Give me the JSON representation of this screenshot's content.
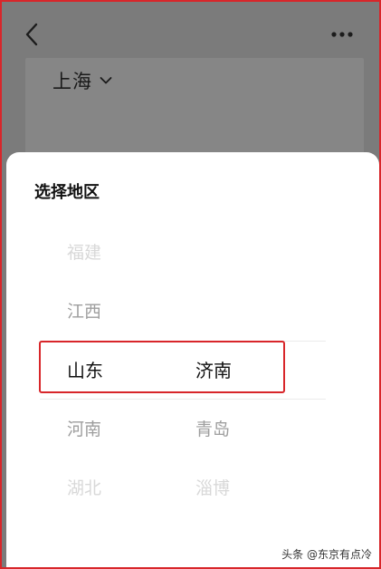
{
  "header": {
    "back_icon": "chevron-left-icon",
    "more_icon": "more-dots-icon"
  },
  "city_selector": {
    "label": "上海",
    "icon": "chevron-down-icon"
  },
  "picker": {
    "title": "选择地区",
    "rows": [
      {
        "province": "福建",
        "city": ""
      },
      {
        "province": "江西",
        "city": ""
      },
      {
        "province": "山东",
        "city": "济南"
      },
      {
        "province": "河南",
        "city": "青岛"
      },
      {
        "province": "湖北",
        "city": "淄博"
      }
    ],
    "selected_index": 2
  },
  "watermark": {
    "text": "头条 @东京有点冷"
  },
  "colors": {
    "overlay_gray": "#7b7b7b",
    "highlight_red": "#d8262a",
    "text_primary": "#111111",
    "text_faded": "#d8d8d8"
  }
}
